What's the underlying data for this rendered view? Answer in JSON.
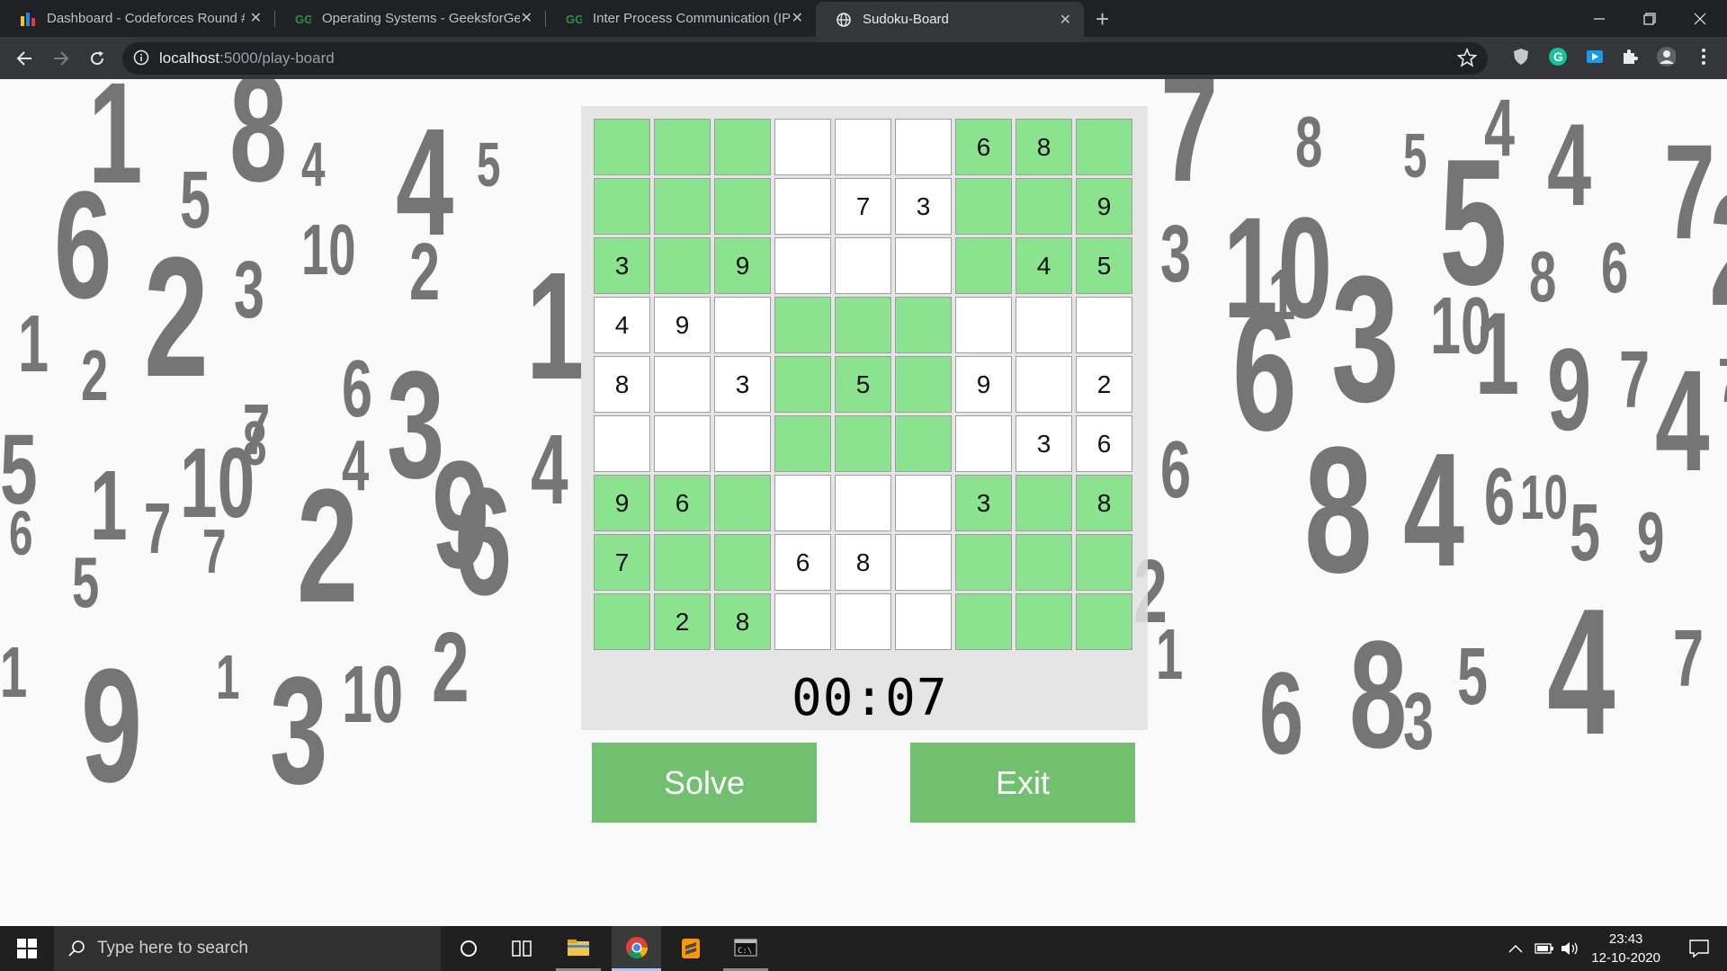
{
  "browser": {
    "tabs": [
      {
        "title": "Dashboard - Codeforces Round #",
        "icon": "codeforces-icon",
        "active": false
      },
      {
        "title": "Operating Systems - GeeksforGe",
        "icon": "geeksforgeeks-icon",
        "active": false
      },
      {
        "title": "Inter Process Communication (IP",
        "icon": "geeksforgeeks-icon",
        "active": false
      },
      {
        "title": "Sudoku-Board",
        "icon": "globe-icon",
        "active": true
      }
    ],
    "url_host": "localhost",
    "url_path": ":5000/play-board"
  },
  "sudoku": {
    "grid": [
      [
        "",
        "",
        "",
        "",
        "",
        "",
        "6",
        "8",
        ""
      ],
      [
        "",
        "",
        "",
        "",
        "7",
        "3",
        "",
        "",
        "9"
      ],
      [
        "3",
        "",
        "9",
        "",
        "",
        "",
        "",
        "4",
        "5"
      ],
      [
        "4",
        "9",
        "",
        "",
        "",
        "",
        "",
        "",
        ""
      ],
      [
        "8",
        "",
        "3",
        "",
        "5",
        "",
        "9",
        "",
        "2"
      ],
      [
        "",
        "",
        "",
        "",
        "",
        "",
        "",
        "3",
        "6"
      ],
      [
        "9",
        "6",
        "",
        "",
        "",
        "",
        "3",
        "",
        "8"
      ],
      [
        "7",
        "",
        "",
        "6",
        "8",
        "",
        "",
        "",
        ""
      ],
      [
        "",
        "2",
        "8",
        "",
        "",
        "",
        "",
        "",
        ""
      ]
    ],
    "green_box_color": "#8be28f",
    "white_box_color": "#ffffff"
  },
  "timer": "00:07",
  "buttons": {
    "solve": "Solve",
    "exit": "Exit"
  },
  "taskbar": {
    "search_placeholder": "Type here to search",
    "time": "23:43",
    "date": "12-10-2020"
  },
  "background_digits": [
    {
      "t": "1"
    },
    {
      "t": "5"
    },
    {
      "t": "8"
    },
    {
      "t": "4"
    },
    {
      "t": "4"
    },
    {
      "t": "5"
    },
    {
      "t": "6"
    },
    {
      "t": "2"
    },
    {
      "t": "3"
    },
    {
      "t": "10"
    },
    {
      "t": "2"
    },
    {
      "t": "1"
    },
    {
      "t": "1"
    },
    {
      "t": "2"
    },
    {
      "t": "6"
    },
    {
      "t": "3"
    },
    {
      "t": "7"
    },
    {
      "t": "4"
    },
    {
      "t": "5"
    },
    {
      "t": "1"
    },
    {
      "t": "10"
    },
    {
      "t": "8"
    },
    {
      "t": "4"
    },
    {
      "t": "9"
    },
    {
      "t": "6"
    },
    {
      "t": "5"
    },
    {
      "t": "7"
    },
    {
      "t": "7"
    },
    {
      "t": "2"
    },
    {
      "t": "6"
    },
    {
      "t": "1"
    },
    {
      "t": "9"
    },
    {
      "t": "1"
    },
    {
      "t": "3"
    },
    {
      "t": "10"
    },
    {
      "t": "2"
    },
    {
      "t": "7"
    },
    {
      "t": "8"
    },
    {
      "t": "10"
    },
    {
      "t": "5"
    },
    {
      "t": "4"
    },
    {
      "t": "4"
    },
    {
      "t": "5"
    },
    {
      "t": "8"
    },
    {
      "t": "6"
    },
    {
      "t": "7"
    },
    {
      "t": "2"
    },
    {
      "t": "1"
    },
    {
      "t": "3"
    },
    {
      "t": "6"
    },
    {
      "t": "3"
    },
    {
      "t": "10"
    },
    {
      "t": "1"
    },
    {
      "t": "9"
    },
    {
      "t": "7"
    },
    {
      "t": "4"
    },
    {
      "t": "7"
    },
    {
      "t": "6"
    },
    {
      "t": "8"
    },
    {
      "t": "4"
    },
    {
      "t": "6"
    },
    {
      "t": "10"
    },
    {
      "t": "5"
    },
    {
      "t": "9"
    },
    {
      "t": "1"
    },
    {
      "t": "6"
    },
    {
      "t": "8"
    },
    {
      "t": "3"
    },
    {
      "t": "5"
    },
    {
      "t": "4"
    },
    {
      "t": "7"
    },
    {
      "t": "2"
    }
  ]
}
